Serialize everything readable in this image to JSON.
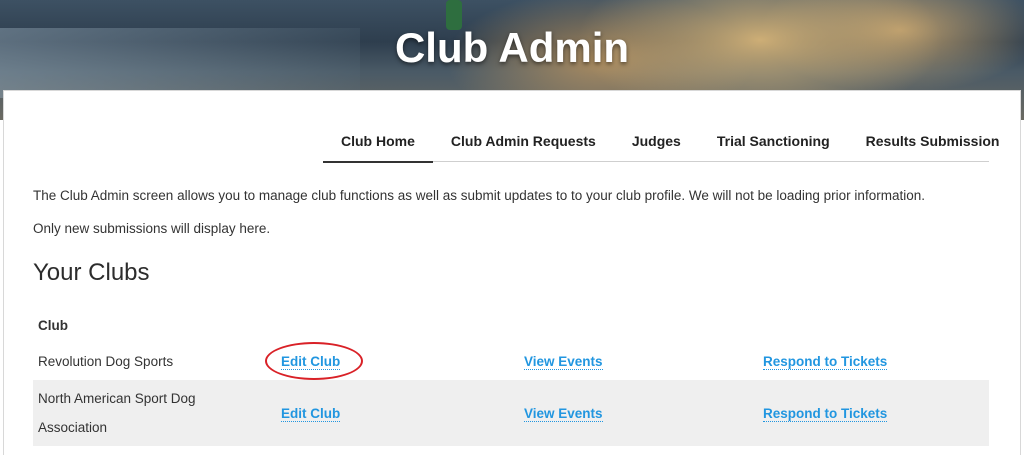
{
  "header": {
    "title": "Club Admin"
  },
  "tabs": [
    {
      "label": "Club Home",
      "active": true
    },
    {
      "label": "Club Admin Requests",
      "active": false
    },
    {
      "label": "Judges",
      "active": false
    },
    {
      "label": "Trial Sanctioning",
      "active": false
    },
    {
      "label": "Results Submission",
      "active": false
    }
  ],
  "intro": {
    "line1": "The Club Admin screen allows you to manage club functions as well as submit updates to to your club profile.  We will not be loading prior information.",
    "line2": "Only new submissions will display here."
  },
  "clubs": {
    "title": "Your Clubs",
    "column_header": "Club",
    "rows": [
      {
        "name": "Revolution Dog Sports",
        "edit": "Edit Club",
        "view": "View Events",
        "respond": "Respond to Tickets"
      },
      {
        "name": "North American Sport Dog Association",
        "edit": "Edit Club",
        "view": "View Events",
        "respond": "Respond to Tickets"
      }
    ]
  },
  "colors": {
    "link": "#2196e0",
    "highlight_circle": "#d92127"
  }
}
